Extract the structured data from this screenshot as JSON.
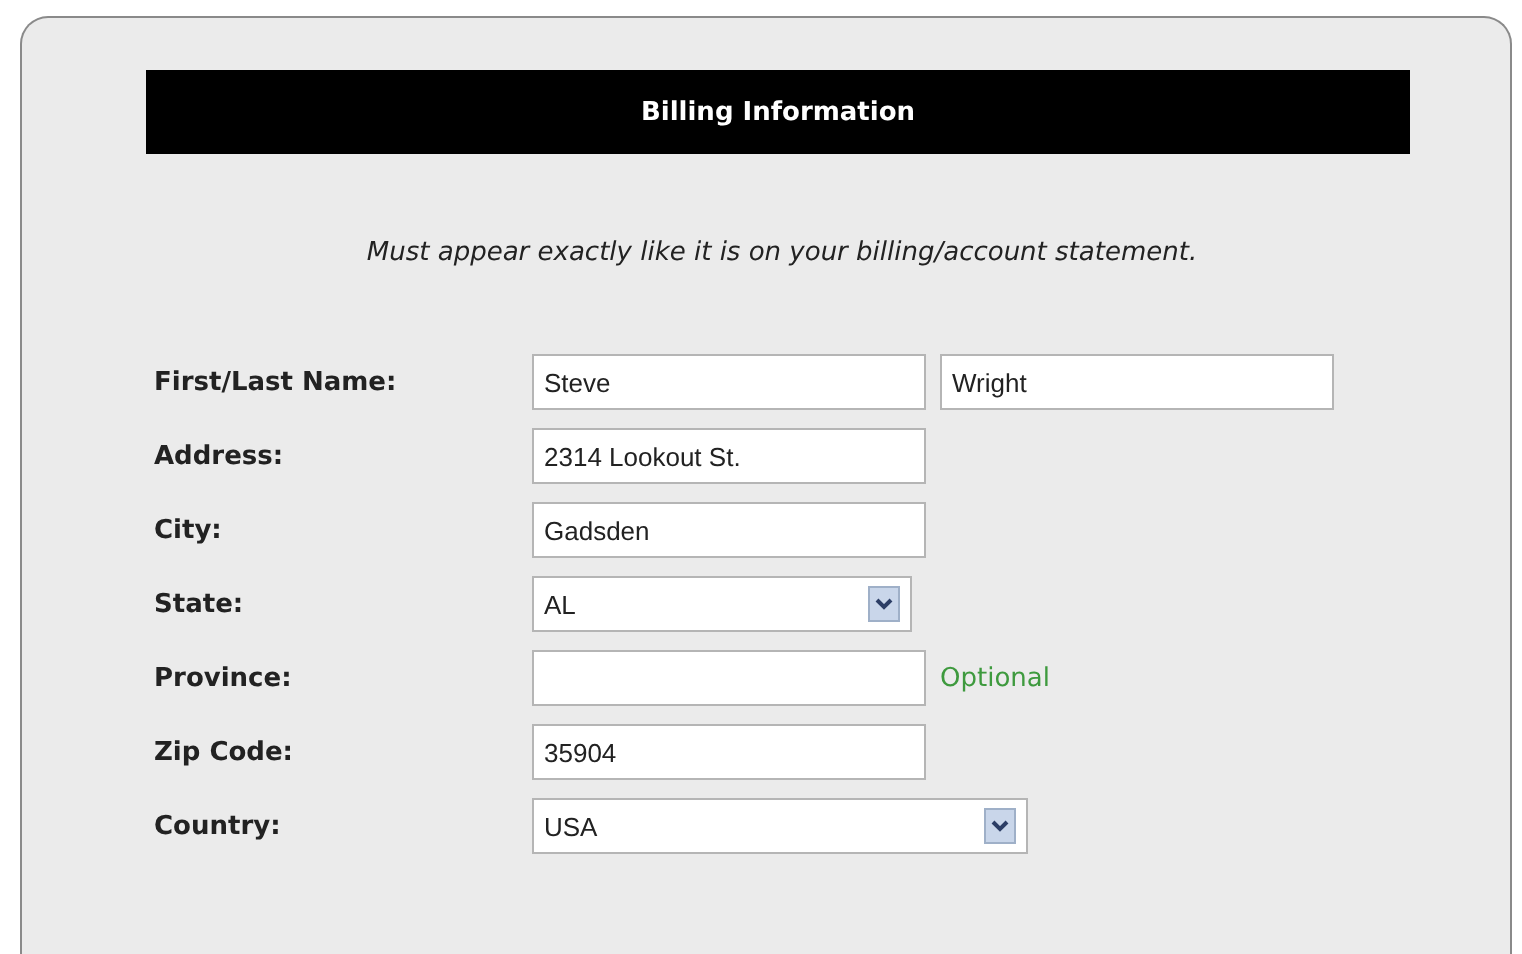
{
  "header": {
    "title": "Billing Information"
  },
  "note": "Must appear exactly like it is on your billing/account statement.",
  "rows": [
    {
      "label": "First/Last Name:",
      "fields": [
        {
          "kind": "text",
          "value": "Steve"
        },
        {
          "kind": "text",
          "value": "Wright"
        }
      ]
    },
    {
      "label": "Address:",
      "fields": [
        {
          "kind": "text",
          "value": "2314 Lookout St."
        }
      ]
    },
    {
      "label": "City:",
      "fields": [
        {
          "kind": "text",
          "value": "Gadsden"
        }
      ]
    },
    {
      "label": "State:",
      "fields": [
        {
          "kind": "select",
          "value": "AL"
        }
      ]
    },
    {
      "label": "Province:",
      "fields": [
        {
          "kind": "text"
        }
      ],
      "hint": "Optional"
    },
    {
      "label": "Zip Code:",
      "fields": [
        {
          "kind": "text",
          "value": "35904"
        }
      ]
    },
    {
      "label": "Country:",
      "fields": [
        {
          "kind": "wide-select",
          "value": "USA"
        }
      ]
    }
  ]
}
